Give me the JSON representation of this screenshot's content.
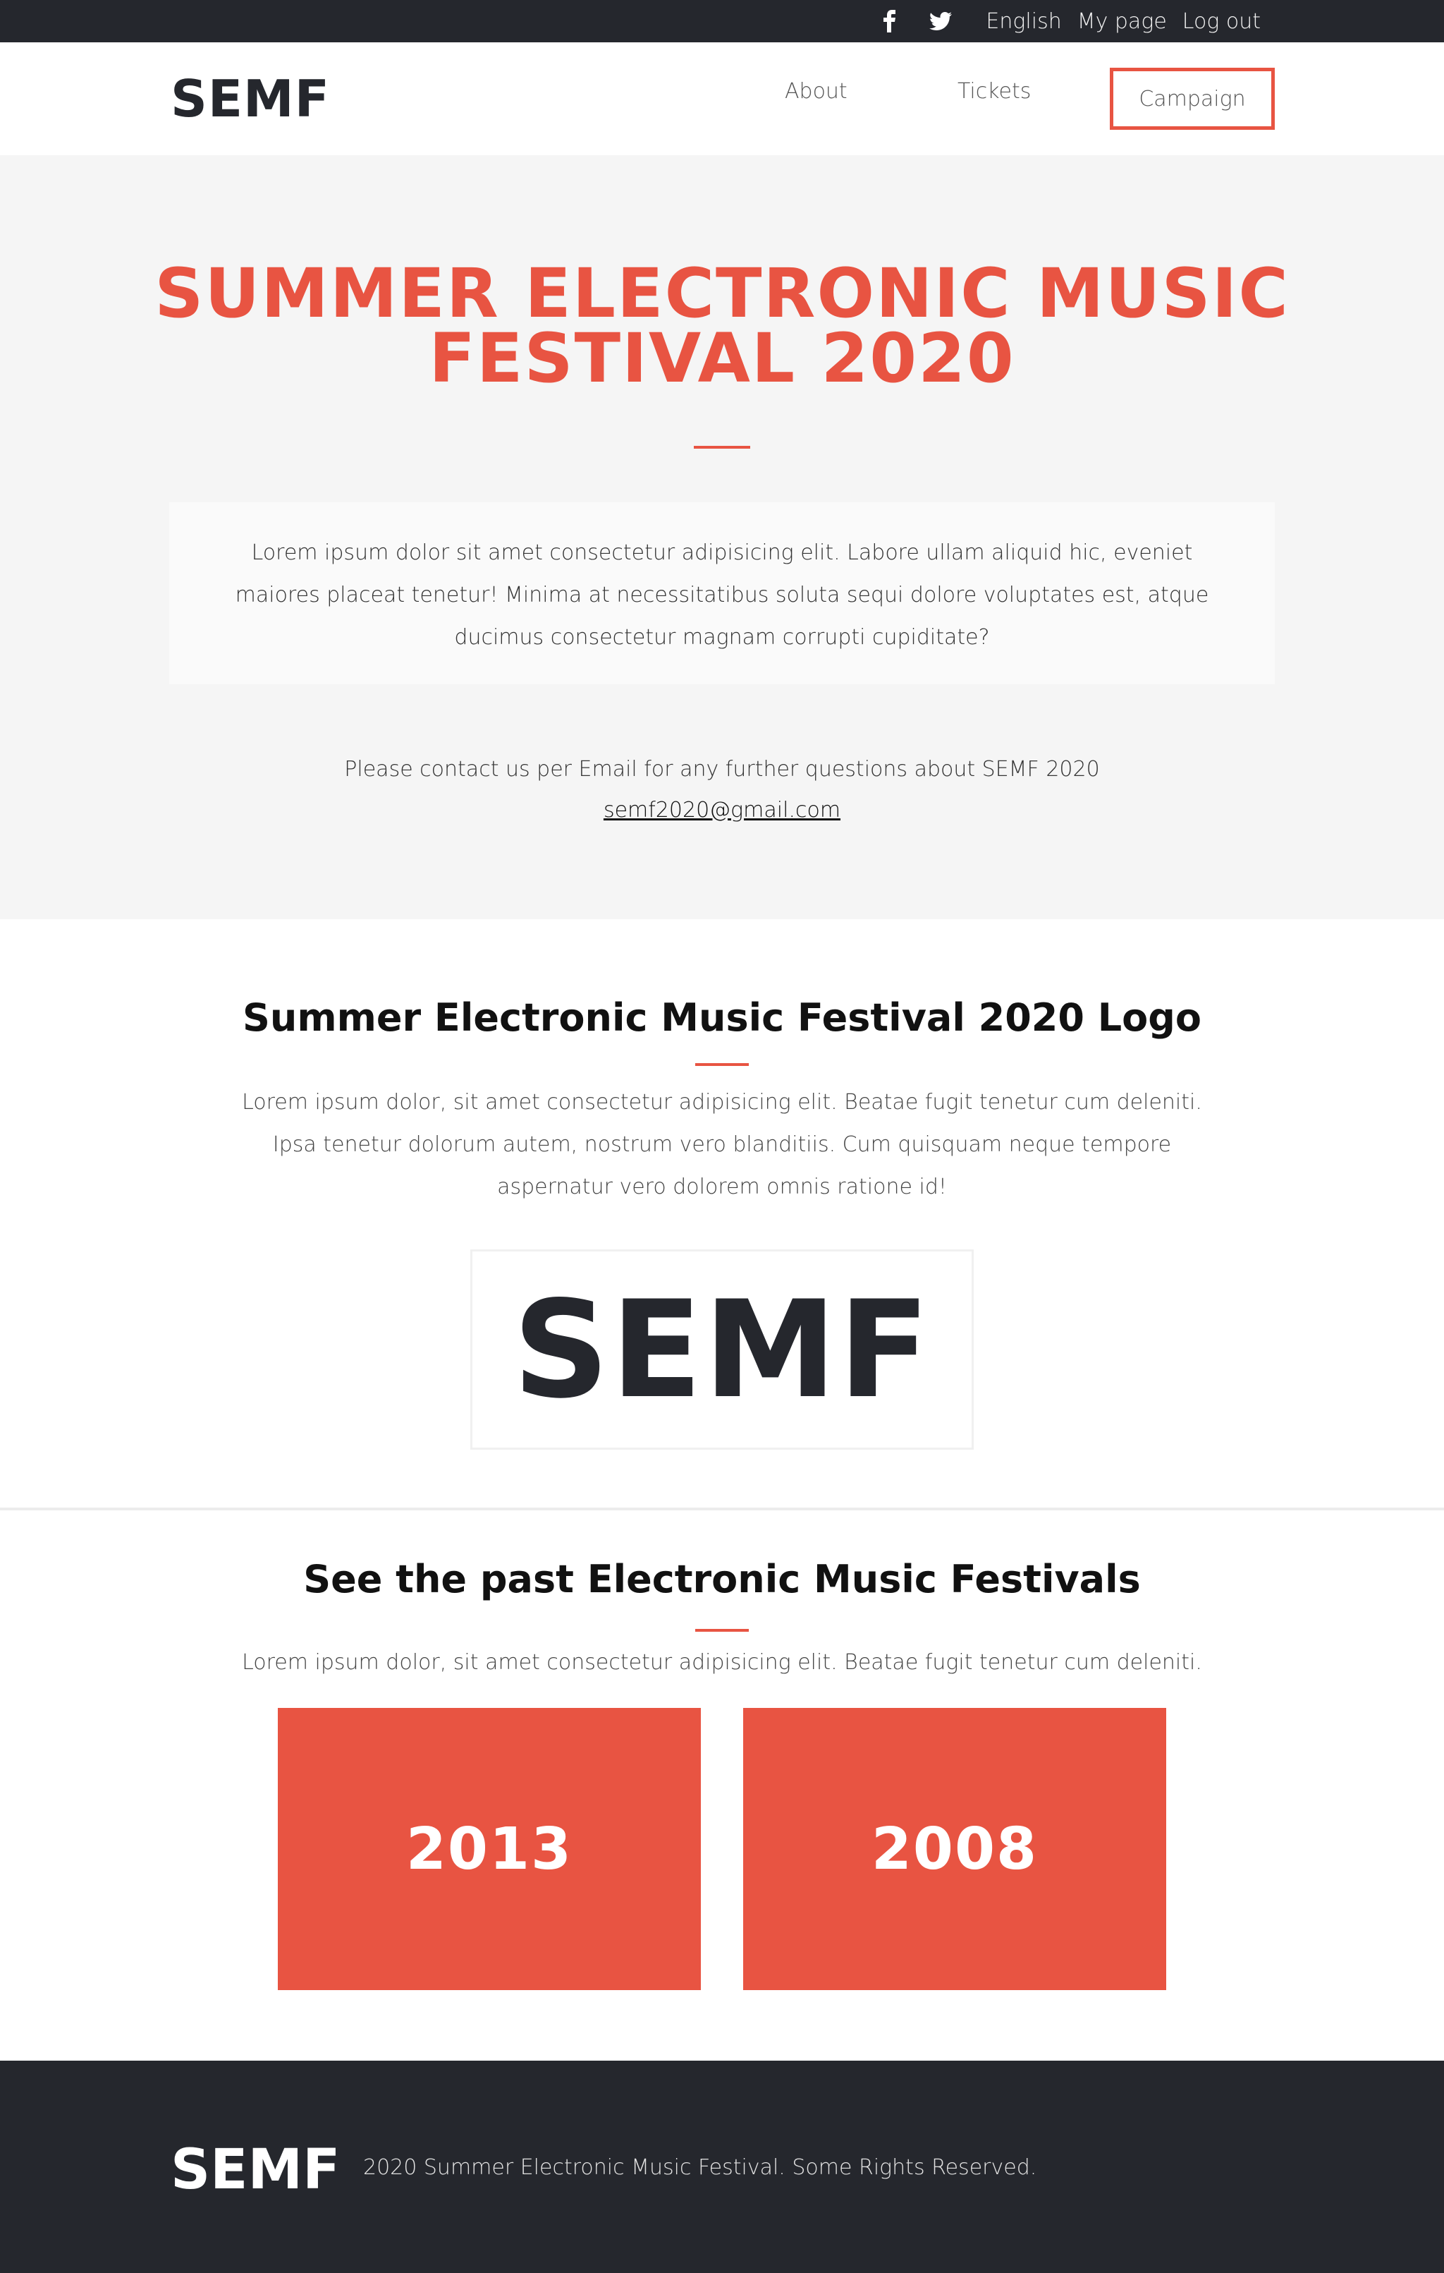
{
  "topbar": {
    "social_icons": [
      "facebook-icon",
      "twitter-icon"
    ],
    "links": [
      "English",
      "My page",
      "Log out"
    ]
  },
  "header": {
    "logo": "SEMF",
    "nav": [
      "About",
      "Tickets",
      "Campaign"
    ]
  },
  "hero": {
    "title_line1": "SUMMER ELECTRONIC MUSIC",
    "title_line2": "FESTIVAL 2020",
    "intro": "Lorem ipsum dolor sit amet consectetur adipisicing elit. Labore ullam aliquid hic, eveniet maiores placeat tenetur! Minima at necessitatibus soluta sequi dolore voluptates est, atque ducimus consectetur magnam corrupti cupiditate?",
    "contact_text": "Please contact us per Email for any further questions about SEMF 2020",
    "email": "semf2020@gmail.com"
  },
  "logo_section": {
    "title": "Summer Electronic Music Festival 2020 Logo",
    "text": "Lorem ipsum dolor, sit amet consectetur adipisicing elit. Beatae fugit tenetur cum deleniti. Ipsa tenetur dolorum autem, nostrum vero blanditiis. Cum quisquam neque tempore aspernatur vero dolorem omnis ratione id!",
    "logo_text": "SEMF"
  },
  "past_section": {
    "title": "See the past Electronic Music Festivals",
    "text": "Lorem ipsum dolor, sit amet consectetur adipisicing elit. Beatae fugit tenetur cum deleniti.",
    "years": [
      "2013",
      "2008"
    ]
  },
  "footer": {
    "logo": "SEMF",
    "copyright": "2020 Summer Electronic Music Festival. Some Rights Reserved."
  },
  "colors": {
    "accent": "#e85442",
    "dark": "#25272d",
    "hero_bg": "#f5f5f5"
  }
}
